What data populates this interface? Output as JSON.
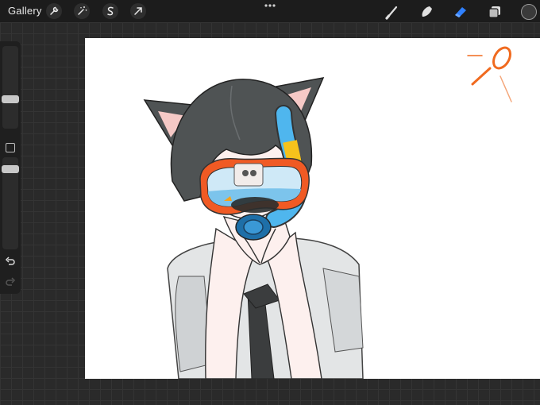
{
  "topbar": {
    "gallery_label": "Gallery",
    "left_tools": [
      "wrench-icon",
      "magic-wand-icon",
      "selection-icon",
      "transform-arrow-icon"
    ],
    "right_tools": [
      "brush-icon",
      "smudge-icon",
      "eraser-icon",
      "layers-icon",
      "color-swatch"
    ],
    "active_tool": "eraser-icon",
    "accent": "#2f80ff"
  },
  "sidebar": {
    "controls": [
      "brush-size-slider",
      "modify-button",
      "opacity-slider",
      "undo-icon",
      "redo-icon"
    ]
  },
  "canvas": {
    "background": "#ffffff"
  }
}
